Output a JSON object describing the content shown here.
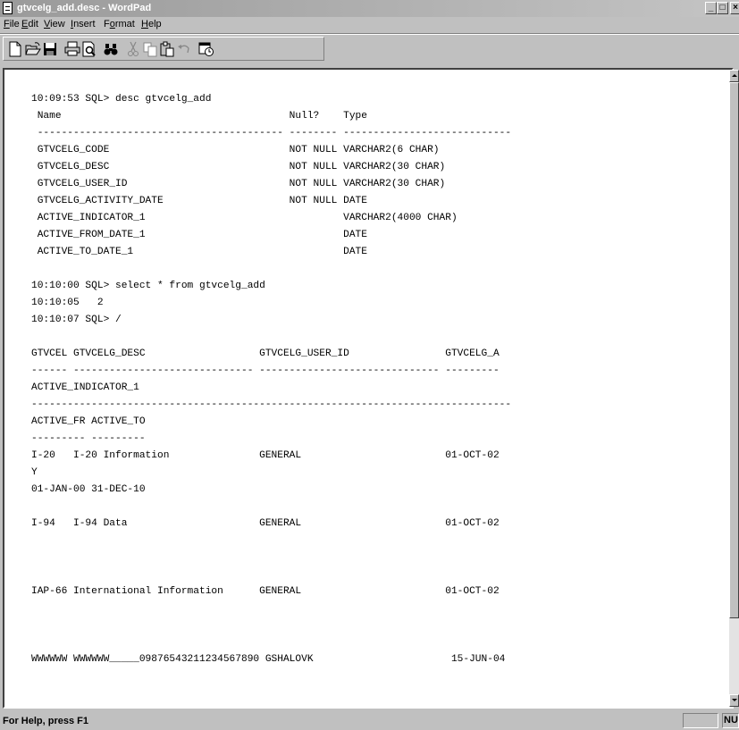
{
  "window": {
    "title": "gtvcelg_add.desc - WordPad",
    "controls": [
      "_",
      "□",
      "×"
    ]
  },
  "menubar": {
    "items": [
      {
        "label": "File",
        "mnemonic": "F"
      },
      {
        "label": "Edit",
        "mnemonic": "E"
      },
      {
        "label": "View",
        "mnemonic": "V"
      },
      {
        "label": "Insert",
        "mnemonic": "I"
      },
      {
        "label": "Format",
        "mnemonic": "o"
      },
      {
        "label": "Help",
        "mnemonic": "H"
      }
    ]
  },
  "toolbar": {
    "buttons": [
      "new-document-icon",
      "open-folder-icon",
      "save-disk-icon",
      "print-icon",
      "print-preview-icon",
      "find-binoculars-icon",
      "cut-scissors-icon",
      "copy-icon",
      "paste-icon",
      "undo-icon",
      "date-time-icon"
    ]
  },
  "document": {
    "lines": [
      "10:09:53 SQL> desc gtvcelg_add",
      " Name                                      Null?    Type",
      " ----------------------------------------- -------- ----------------------------",
      " GTVCELG_CODE                              NOT NULL VARCHAR2(6 CHAR)",
      " GTVCELG_DESC                              NOT NULL VARCHAR2(30 CHAR)",
      " GTVCELG_USER_ID                           NOT NULL VARCHAR2(30 CHAR)",
      " GTVCELG_ACTIVITY_DATE                     NOT NULL DATE",
      " ACTIVE_INDICATOR_1                                 VARCHAR2(4000 CHAR)",
      " ACTIVE_FROM_DATE_1                                 DATE",
      " ACTIVE_TO_DATE_1                                   DATE",
      "",
      "10:10:00 SQL> select * from gtvcelg_add",
      "10:10:05   2",
      "10:10:07 SQL> /",
      "",
      "GTVCEL GTVCELG_DESC                   GTVCELG_USER_ID                GTVCELG_A",
      "------ ------------------------------ ------------------------------ ---------",
      "ACTIVE_INDICATOR_1",
      "--------------------------------------------------------------------------------",
      "ACTIVE_FR ACTIVE_TO",
      "--------- ---------",
      "I-20   I-20 Information               GENERAL                        01-OCT-02",
      "Y",
      "01-JAN-00 31-DEC-10",
      "",
      "I-94   I-94 Data                      GENERAL                        01-OCT-02",
      "",
      "",
      "",
      "IAP-66 International Information      GENERAL                        01-OCT-02",
      "",
      "",
      "",
      "WWWWWW WWWWWW_____09876543211234567890 GSHALOVK                       15-JUN-04"
    ]
  },
  "statusbar": {
    "help_text": "For Help, press F1",
    "num_indicator": "NUM"
  }
}
